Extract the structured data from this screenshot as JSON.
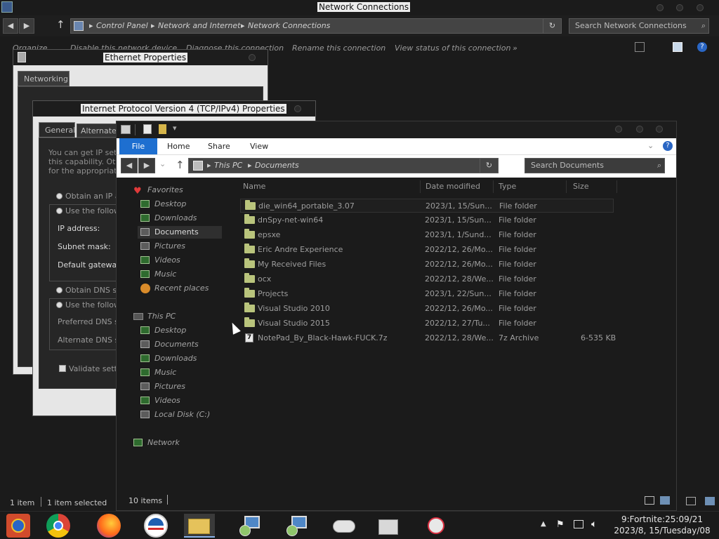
{
  "network_window": {
    "title": "Network Connections",
    "breadcrumb": [
      "Control Panel",
      "Network and Internet",
      "Network Connections"
    ],
    "search_placeholder": "Search Network Connections",
    "commands": [
      "Organize",
      "Disable this network device",
      "Diagnose this connection",
      "Rename this connection",
      "View status of this connection"
    ],
    "status_items": "1 item",
    "status_selected": "1 item selected"
  },
  "ethernet_dialog": {
    "title": "Ethernet Properties",
    "tab": "Networking"
  },
  "tcp_dialog": {
    "title": "Internet Protocol Version 4 (TCP/IPv4) Properties",
    "tabs": [
      "General",
      "Alternate"
    ],
    "intro": [
      "You can get IP setti",
      "this capability. Othe",
      "for the appropriate"
    ],
    "obtain_ip": "Obtain an IP ac",
    "use_following_ip": "Use the followi",
    "ip_address": "IP address:",
    "subnet_mask": "Subnet mask:",
    "default_gateway": "Default gateway:",
    "obtain_dns": "Obtain DNS ser",
    "use_following_dns": "Use the followi",
    "preferred_dns": "Preferred DNS se",
    "alternate_dns": "Alternate DNS se",
    "validate": "Validate settin"
  },
  "explorer": {
    "ribbon_tabs": [
      "File",
      "Home",
      "Share",
      "View"
    ],
    "breadcrumb": [
      "This PC",
      "Documents"
    ],
    "search_placeholder": "Search Documents",
    "nav_tree": {
      "favorites_label": "Favorites",
      "favorites": [
        "Desktop",
        "Downloads",
        "Documents",
        "Pictures",
        "Videos",
        "Music",
        "Recent places"
      ],
      "this_pc_label": "This PC",
      "this_pc": [
        "Desktop",
        "Documents",
        "Downloads",
        "Music",
        "Pictures",
        "Videos",
        "Local Disk (C:)"
      ],
      "network_label": "Network"
    },
    "columns": [
      "Name",
      "Date modified",
      "Type",
      "Size"
    ],
    "files": [
      {
        "name": "die_win64_portable_3.07",
        "date": "2023/1, 15/Sun...",
        "type": "File folder",
        "size": ""
      },
      {
        "name": "dnSpy-net-win64",
        "date": "2023/1, 15/Sun...",
        "type": "File folder",
        "size": ""
      },
      {
        "name": "epsxe",
        "date": "2023/1, 1/Sund...",
        "type": "File folder",
        "size": ""
      },
      {
        "name": "Eric Andre Experience",
        "date": "2022/12, 26/Mo...",
        "type": "File folder",
        "size": ""
      },
      {
        "name": "My Received Files",
        "date": "2022/12, 26/Mo...",
        "type": "File folder",
        "size": ""
      },
      {
        "name": "ocx",
        "date": "2022/12, 28/We...",
        "type": "File folder",
        "size": ""
      },
      {
        "name": "Projects",
        "date": "2023/1, 22/Sun...",
        "type": "File folder",
        "size": ""
      },
      {
        "name": "Visual Studio 2010",
        "date": "2022/12, 26/Mo...",
        "type": "File folder",
        "size": ""
      },
      {
        "name": "Visual Studio 2015",
        "date": "2022/12, 27/Tu...",
        "type": "File folder",
        "size": ""
      },
      {
        "name": "NotePad_By_Black-Hawk-FUCK.7z",
        "date": "2022/12, 28/We...",
        "type": "7z Archive",
        "size": "6-535 KB"
      }
    ],
    "status_count": "10 items"
  },
  "taskbar": {
    "clock_time": "9:Fortnite:25:09/21",
    "clock_date": "2023/8, 15/Tuesday/08",
    "apps": [
      "media-player-icon",
      "chrome-icon",
      "firefox-icon",
      "obama-logo-icon",
      "file-explorer-icon",
      "network-setup-icon",
      "network-setup-icon-2",
      "gamepad-icon",
      "cash-register-icon",
      "snipping-tool-icon"
    ]
  }
}
